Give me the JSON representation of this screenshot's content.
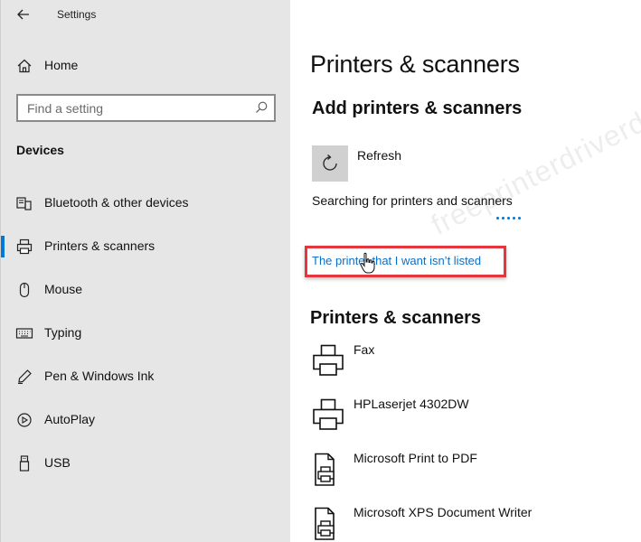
{
  "app": {
    "title": "Settings"
  },
  "sidebar": {
    "home_label": "Home",
    "search_placeholder": "Find a setting",
    "section_header": "Devices",
    "items": [
      {
        "label": "Bluetooth & other devices",
        "icon": "bluetooth-devices-icon"
      },
      {
        "label": "Printers & scanners",
        "icon": "printer-icon",
        "active": true
      },
      {
        "label": "Mouse",
        "icon": "mouse-icon"
      },
      {
        "label": "Typing",
        "icon": "keyboard-icon"
      },
      {
        "label": "Pen & Windows Ink",
        "icon": "pen-icon"
      },
      {
        "label": "AutoPlay",
        "icon": "autoplay-icon"
      },
      {
        "label": "USB",
        "icon": "usb-icon"
      }
    ]
  },
  "main": {
    "title": "Printers & scanners",
    "add_section": {
      "title": "Add printers & scanners",
      "refresh_label": "Refresh",
      "searching_text": "Searching for printers and scanners",
      "link_text": "The printer that I want isn’t listed"
    },
    "devices_section": {
      "title": "Printers & scanners",
      "devices": [
        {
          "name": "Fax",
          "icon": "printer-icon"
        },
        {
          "name": "HPLaserjet 4302DW",
          "icon": "printer-icon"
        },
        {
          "name": "Microsoft Print to PDF",
          "icon": "document-printer-icon"
        },
        {
          "name": "Microsoft XPS Document Writer",
          "icon": "document-printer-icon"
        }
      ]
    }
  },
  "watermark": "freeprinterdriverdownload.org",
  "colors": {
    "accent": "#0078d7",
    "link": "#0a6fc9",
    "highlight": "#e5363d",
    "sidebar_bg": "#e6e6e6"
  }
}
